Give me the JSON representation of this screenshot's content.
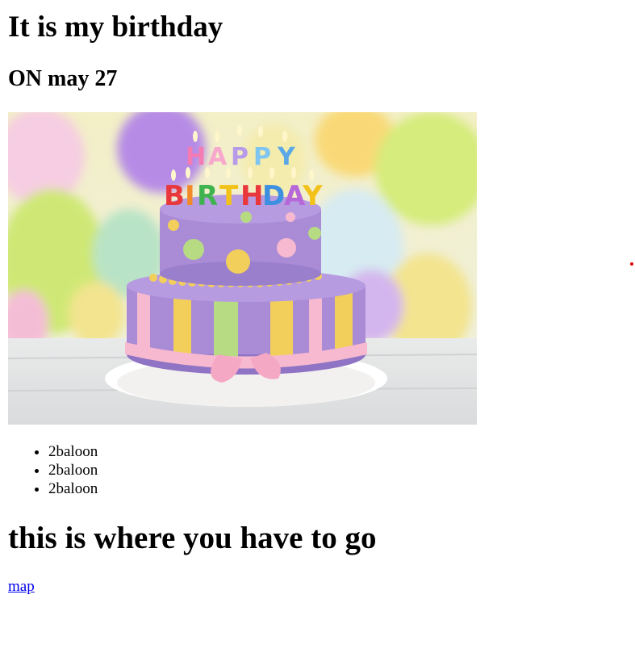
{
  "title": "It is my birthday",
  "subtitle": "ON may 27",
  "photo": {
    "candle_letters_top": [
      "H",
      "A",
      "P",
      "P",
      "Y"
    ],
    "candle_letters_bottom": [
      "B",
      "I",
      "R",
      "T",
      "H",
      "D",
      "A",
      "Y"
    ]
  },
  "list": {
    "items": [
      "2baloon",
      "2baloon",
      "2baloon"
    ]
  },
  "section_heading": "this is where you have to go",
  "map_link": "map",
  "colors": {
    "link": "#0000ee",
    "marker_dot": "#e00000",
    "cake_purple": "#a98bd6",
    "ribbon_pink": "#f7b9cf",
    "stripe_yellow": "#f2cf5a",
    "stripe_green": "#b7db82"
  }
}
